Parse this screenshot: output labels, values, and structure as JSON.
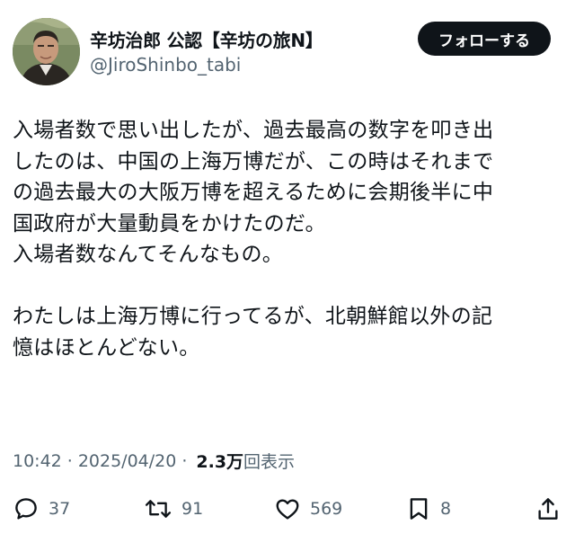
{
  "author": {
    "display_name": "辛坊治郎 公認【辛坊の旅N】",
    "handle": "@JiroShinbo_tabi"
  },
  "follow_button_label": "フォローする",
  "body_text": "入場者数で思い出したが、過去最高の数字を叩き出\nしたのは、中国の上海万博だが、この時はそれまで\nの過去最大の大阪万博を超えるために会期後半に中\n国政府が大量動員をかけたのだ。\n入場者数なんてそんなもの。\n\nわたしは上海万博に行ってるが、北朝鮮館以外の記\n憶はほとんどない。",
  "meta": {
    "time": "10:42",
    "separator": "·",
    "date": "2025/04/20",
    "views_count": "2.3万",
    "views_label": "回表示"
  },
  "actions": {
    "replies": "37",
    "reposts": "91",
    "likes": "569",
    "bookmarks": "8"
  },
  "icons": {
    "reply": "speech-bubble-icon",
    "repost": "repost-arrows-icon",
    "like": "heart-icon",
    "bookmark": "bookmark-icon",
    "share": "share-upload-icon"
  },
  "colors": {
    "text_primary": "#0f1419",
    "text_secondary": "#536471",
    "button_bg": "#0f1419",
    "button_text": "#ffffff",
    "background": "#ffffff"
  }
}
